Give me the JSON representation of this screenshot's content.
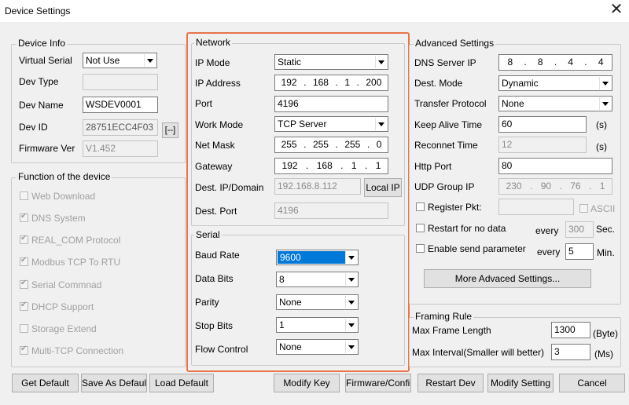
{
  "window": {
    "title": "Device Settings",
    "close": "✕"
  },
  "device_info": {
    "legend": "Device Info",
    "virtual_serial_label": "Virtual Serial",
    "virtual_serial": "Not Use",
    "dev_type_label": "Dev Type",
    "dev_type": "",
    "dev_name_label": "Dev Name",
    "dev_name": "WSDEV0001",
    "dev_id_label": "Dev ID",
    "dev_id": "28751ECC4F03",
    "dev_id_btn": "[--]",
    "firmware_label": "Firmware Ver",
    "firmware": "V1.452"
  },
  "functions": {
    "legend": "Function of the device",
    "items": [
      {
        "label": "Web Download",
        "checked": false
      },
      {
        "label": "DNS System",
        "checked": true
      },
      {
        "label": "REAL_COM Protocol",
        "checked": true
      },
      {
        "label": "Modbus TCP To RTU",
        "checked": true
      },
      {
        "label": "Serial Commnad",
        "checked": true
      },
      {
        "label": "DHCP Support",
        "checked": true
      },
      {
        "label": "Storage Extend",
        "checked": false
      },
      {
        "label": "Multi-TCP Connection",
        "checked": true
      }
    ]
  },
  "network": {
    "legend": "Network",
    "ip_mode_label": "IP Mode",
    "ip_mode": "Static",
    "ip_address_label": "IP Address",
    "ip_address": [
      "192",
      "168",
      "1",
      "200"
    ],
    "port_label": "Port",
    "port": "4196",
    "work_mode_label": "Work Mode",
    "work_mode": "TCP Server",
    "net_mask_label": "Net Mask",
    "net_mask": [
      "255",
      "255",
      "255",
      "0"
    ],
    "gateway_label": "Gateway",
    "gateway": [
      "192",
      "168",
      "1",
      "1"
    ],
    "dest_ip_label": "Dest. IP/Domain",
    "dest_ip": "192.168.8.112",
    "local_ip_btn": "Local IP",
    "dest_port_label": "Dest. Port",
    "dest_port": "4196"
  },
  "serial": {
    "legend": "Serial",
    "baud_rate_label": "Baud Rate",
    "baud_rate": "9600",
    "data_bits_label": "Data Bits",
    "data_bits": "8",
    "parity_label": "Parity",
    "parity": "None",
    "stop_bits_label": "Stop Bits",
    "stop_bits": "1",
    "flow_control_label": "Flow Control",
    "flow_control": "None"
  },
  "advanced": {
    "legend": "Advanced Settings",
    "dns_label": "DNS Server IP",
    "dns": [
      "8",
      "8",
      "4",
      "4"
    ],
    "dest_mode_label": "Dest. Mode",
    "dest_mode": "Dynamic",
    "transfer_label": "Transfer Protocol",
    "transfer": "None",
    "keep_alive_label": "Keep Alive Time",
    "keep_alive": "60",
    "keep_alive_unit": "(s)",
    "reconnect_label": "Reconnet Time",
    "reconnect": "12",
    "reconnect_unit": "(s)",
    "http_port_label": "Http Port",
    "http_port": "80",
    "udp_group_label": "UDP Group IP",
    "udp_group": [
      "230",
      "90",
      "76",
      "1"
    ],
    "register_label": "Register Pkt:",
    "register": "",
    "ascii_label": "ASCII",
    "restart_label": "Restart for no data",
    "restart_every": "every",
    "restart_value": "300",
    "restart_unit": "Sec.",
    "send_param_label": "Enable send parameter",
    "send_every": "every",
    "send_value": "5",
    "send_unit": "Min.",
    "more_btn": "More Advaced Settings..."
  },
  "framing": {
    "legend": "Framing Rule",
    "max_len_label": "Max Frame Length",
    "max_len": "1300",
    "max_len_unit": "(Byte)",
    "max_int_label": "Max Interval(Smaller will better)",
    "max_int": "3",
    "max_int_unit": "(Ms)"
  },
  "buttons": {
    "get_default": "Get Default",
    "save_default": "Save As Default",
    "load_default": "Load Default",
    "modify_key": "Modify Key",
    "firmware_config": "Firmware/Config",
    "restart_dev": "Restart Dev",
    "modify_setting": "Modify Setting",
    "cancel": "Cancel"
  }
}
